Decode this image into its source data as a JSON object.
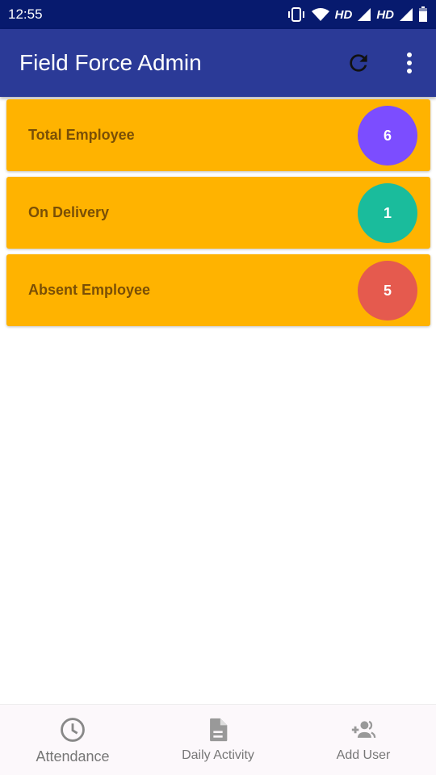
{
  "status_bar": {
    "time": "12:55",
    "network_label_1": "HD",
    "network_label_2": "HD"
  },
  "app_bar": {
    "title": "Field Force Admin",
    "refresh_icon": "refresh-icon",
    "more_icon": "more-vert-icon"
  },
  "cards": [
    {
      "label": "Total Employee",
      "count": "6",
      "badge_color": "#7c4dff"
    },
    {
      "label": "On Delivery",
      "count": "1",
      "badge_color": "#1abc9c"
    },
    {
      "label": "Absent Employee",
      "count": "5",
      "badge_color": "#e55a4e"
    }
  ],
  "bottom_nav": {
    "items": [
      {
        "label": "Attendance",
        "icon": "clock-icon"
      },
      {
        "label": "Daily Activity",
        "icon": "document-icon"
      },
      {
        "label": "Add User",
        "icon": "add-user-icon"
      }
    ]
  }
}
